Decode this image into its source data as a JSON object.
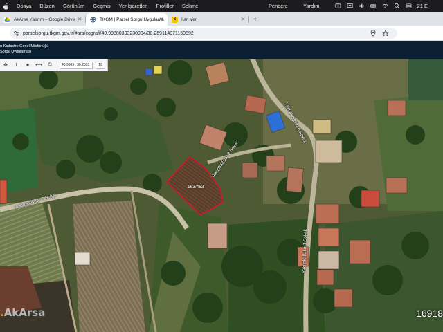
{
  "menubar": {
    "items": [
      "Dosya",
      "Düzen",
      "Görünüm",
      "Geçmiş",
      "Yer İşaretleri",
      "Profiller",
      "Sekme"
    ],
    "right_items": [
      "Pencere",
      "Yardım"
    ],
    "clock": "21 E"
  },
  "tabs": [
    {
      "label": "AkArsa Yatırım – Google Drive",
      "fav_color": "#4285f4",
      "fav_glyph": ""
    },
    {
      "label": "TKGM | Parsel Sorgu Uygulama",
      "fav_color": "#1a73e8",
      "fav_glyph": ""
    },
    {
      "label": "İlan Ver",
      "fav_color": "#f5c400",
      "fav_glyph": "S"
    }
  ],
  "address_bar": {
    "url": "parselsorgu.tkgm.gov.tr/#ara/cografi/40.99880393230934/30.269114971160892"
  },
  "site_header": {
    "line1": "u Kadastro Genel Müdürlüğü",
    "line2": "Sorgu Uygulaması"
  },
  "map_tools": {
    "coordinates": "40.9989 : 30.2693",
    "zoom": "19"
  },
  "map": {
    "road_labels": [
      "Yakupkalfalar 2 Sokak",
      "Yakupkalfalar 3 Sokak",
      "Yakupkalfalar 1 Sokak",
      "Yakupkalfalar 6 Sokak"
    ],
    "parcel_label": "163/463",
    "watermark": "AkArsa",
    "watermark_dot": ".",
    "id_overlay": "16918",
    "parcel_color": "#d0162a"
  }
}
